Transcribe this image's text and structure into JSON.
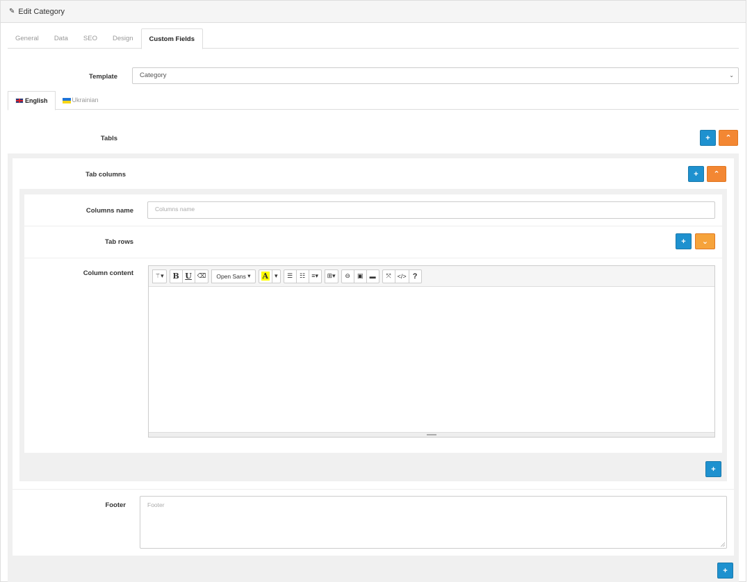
{
  "header": {
    "title": "Edit Category"
  },
  "tabs": [
    {
      "label": "General"
    },
    {
      "label": "Data"
    },
    {
      "label": "SEO"
    },
    {
      "label": "Design"
    },
    {
      "label": "Custom Fields"
    }
  ],
  "active_tab": "Custom Fields",
  "template": {
    "label": "Template",
    "value": "Category"
  },
  "languages": [
    {
      "label": "English"
    },
    {
      "label": "Ukrainian"
    }
  ],
  "tabls": {
    "label": "Tabls",
    "add": "+",
    "toggle": "^"
  },
  "tab_columns": {
    "label": "Tab columns",
    "add": "+",
    "toggle": "^"
  },
  "columns_name": {
    "label": "Columns name",
    "placeholder": "Columns name"
  },
  "tab_rows": {
    "label": "Tab rows",
    "add": "+",
    "toggle": "v"
  },
  "column_content": {
    "label": "Column content",
    "toolbar": {
      "font": "Open Sans",
      "bold": "B",
      "underline": "U",
      "highlight": "A",
      "help": "?"
    }
  },
  "add_column": "+",
  "footer": {
    "label": "Footer",
    "placeholder": "Footer"
  },
  "add_tab": "+",
  "colors": {
    "blue": "#1e91cf",
    "orange": "#f38733",
    "well": "#f0f0f0"
  }
}
